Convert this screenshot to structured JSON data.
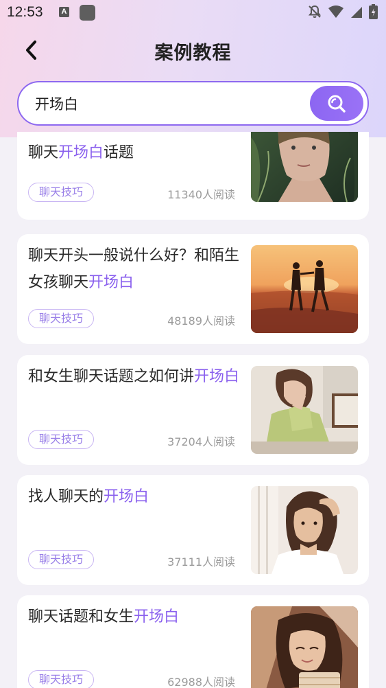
{
  "status_bar": {
    "time": "12:53",
    "notification_icon_letter": "A"
  },
  "nav": {
    "title": "案例教程"
  },
  "search": {
    "value": "开场白"
  },
  "articles": [
    {
      "title_before": "聊天",
      "title_highlight": "开场白",
      "title_after": "话题",
      "tag": "聊天技巧",
      "reads": "11340人阅读"
    },
    {
      "title_before": "聊天开头一般说什么好？和陌生女孩聊天",
      "title_highlight": "开场白",
      "title_after": "",
      "tag": "聊天技巧",
      "reads": "48189人阅读"
    },
    {
      "title_before": "和女生聊天话题之如何讲",
      "title_highlight": "开场白",
      "title_after": "",
      "tag": "聊天技巧",
      "reads": "37204人阅读"
    },
    {
      "title_before": "找人聊天的",
      "title_highlight": "开场白",
      "title_after": "",
      "tag": "聊天技巧",
      "reads": "37111人阅读"
    },
    {
      "title_before": "聊天话题和女生",
      "title_highlight": "开场白",
      "title_after": "",
      "tag": "聊天技巧",
      "reads": "62988人阅读"
    }
  ],
  "colors": {
    "accent": "#8a60ee",
    "background": "#f3f1f7",
    "card": "#ffffff"
  }
}
